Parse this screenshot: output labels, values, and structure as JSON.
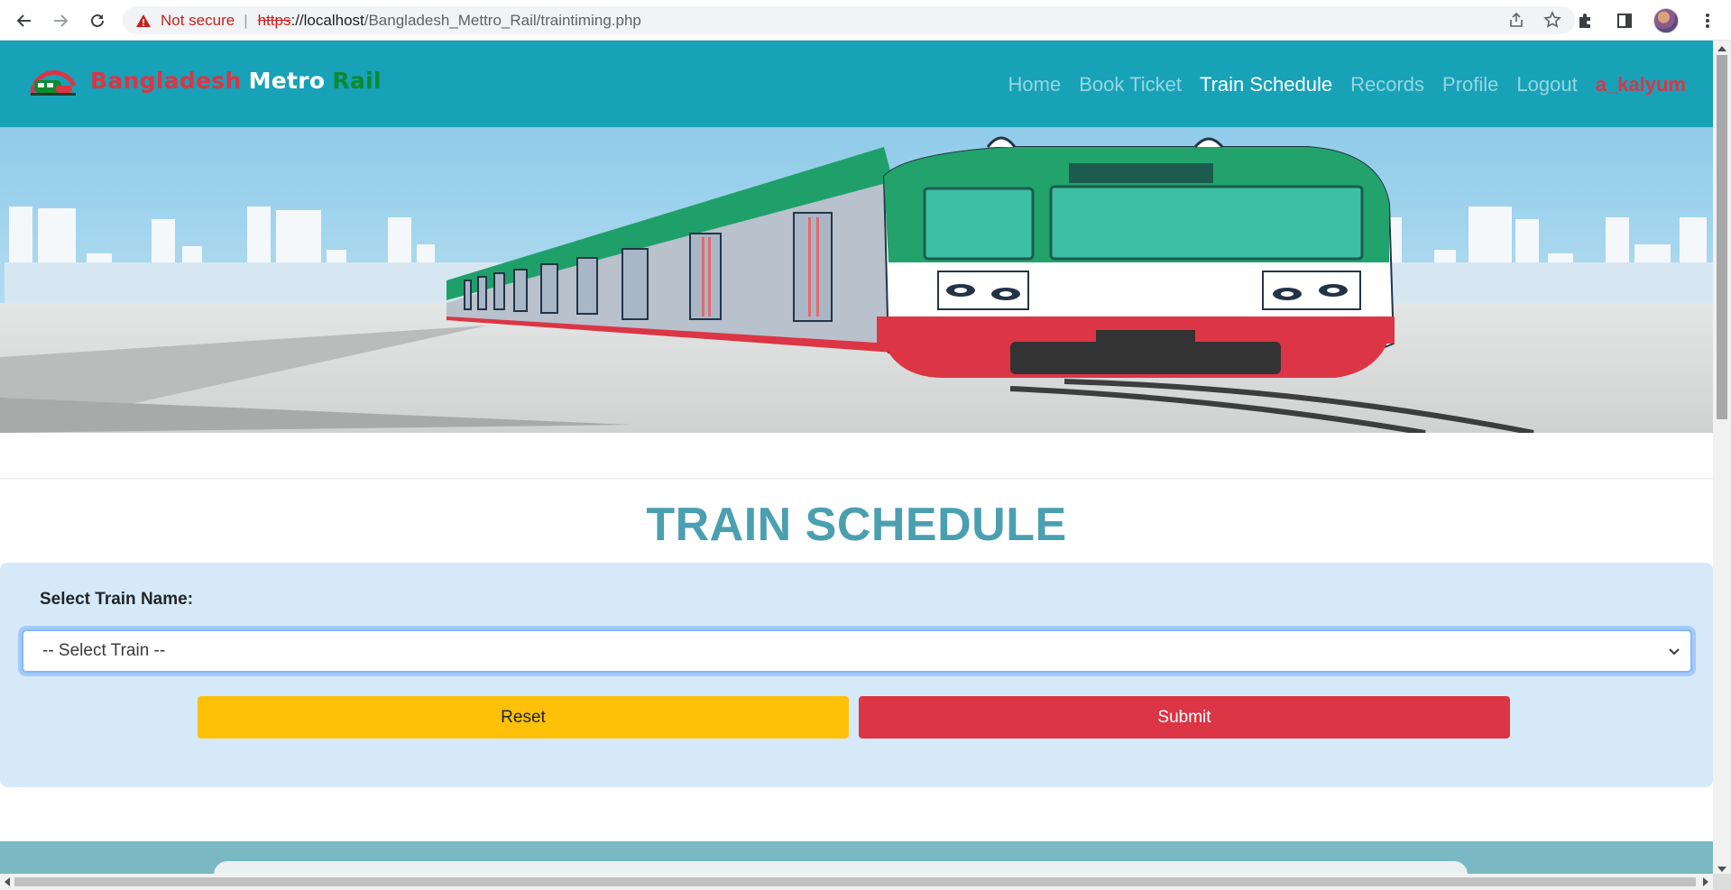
{
  "browser": {
    "security_label": "Not secure",
    "url_scheme": "https",
    "url_host": "://localhost",
    "url_path": "/Bangladesh_Mettro_Rail/traintiming.php"
  },
  "site": {
    "brand": {
      "part1": "Bangladesh",
      "part2": "Metro",
      "part3": "Rail"
    },
    "nav": {
      "home": "Home",
      "book_ticket": "Book Ticket",
      "train_schedule": "Train Schedule",
      "records": "Records",
      "profile": "Profile",
      "logout": "Logout",
      "user": "a_kalyum"
    },
    "active_nav": "train_schedule"
  },
  "schedule": {
    "title": "TRAIN SCHEDULE",
    "select_label": "Select Train Name:",
    "select_value": "-- Select Train --",
    "reset_label": "Reset",
    "submit_label": "Submit"
  },
  "colors": {
    "navbar": "#17a2b8",
    "brand_red": "#dc3545",
    "brand_green": "#0d8a2f",
    "title": "#4a9fb0",
    "panel": "#d6e9f8",
    "reset": "#ffc107",
    "submit": "#dc3545"
  }
}
